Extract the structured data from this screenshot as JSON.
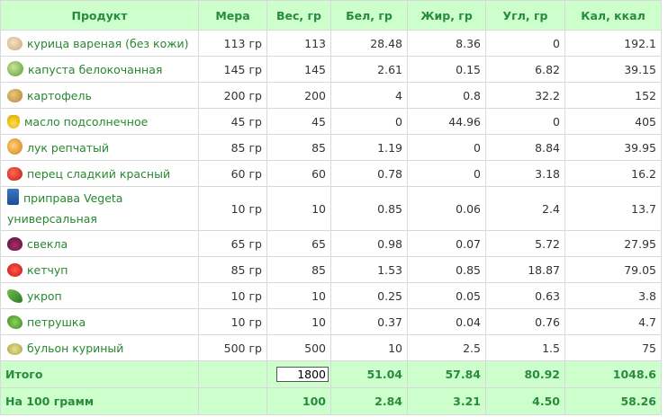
{
  "headers": {
    "product": "Продукт",
    "measure": "Мера",
    "weight": "Вес, гр",
    "protein": "Бел, гр",
    "fat": "Жир, гр",
    "carbs": "Угл, гр",
    "calories": "Кал, ккал"
  },
  "rows": [
    {
      "icon": "chicken-icon",
      "name": "курица вареная (без кожи)",
      "measure": "113 гр",
      "weight": "113",
      "protein": "28.48",
      "fat": "8.36",
      "carbs": "0",
      "calories": "192.1"
    },
    {
      "icon": "cabbage-icon",
      "name": "капуста белокочанная",
      "measure": "145 гр",
      "weight": "145",
      "protein": "2.61",
      "fat": "0.15",
      "carbs": "6.82",
      "calories": "39.15"
    },
    {
      "icon": "potato-icon",
      "name": "картофель",
      "measure": "200 гр",
      "weight": "200",
      "protein": "4",
      "fat": "0.8",
      "carbs": "32.2",
      "calories": "152"
    },
    {
      "icon": "oil-icon",
      "name": "масло подсолнечное",
      "measure": "45 гр",
      "weight": "45",
      "protein": "0",
      "fat": "44.96",
      "carbs": "0",
      "calories": "405"
    },
    {
      "icon": "onion-icon",
      "name": "лук репчатый",
      "measure": "85 гр",
      "weight": "85",
      "protein": "1.19",
      "fat": "0",
      "carbs": "8.84",
      "calories": "39.95"
    },
    {
      "icon": "pepper-icon",
      "name": "перец сладкий красный",
      "measure": "60 гр",
      "weight": "60",
      "protein": "0.78",
      "fat": "0",
      "carbs": "3.18",
      "calories": "16.2"
    },
    {
      "icon": "vegeta-icon",
      "name": "приправа Vegeta универсальная",
      "measure": "10 гр",
      "weight": "10",
      "protein": "0.85",
      "fat": "0.06",
      "carbs": "2.4",
      "calories": "13.7"
    },
    {
      "icon": "beet-icon",
      "name": "свекла",
      "measure": "65 гр",
      "weight": "65",
      "protein": "0.98",
      "fat": "0.07",
      "carbs": "5.72",
      "calories": "27.95"
    },
    {
      "icon": "ketchup-icon",
      "name": "кетчуп",
      "measure": "85 гр",
      "weight": "85",
      "protein": "1.53",
      "fat": "0.85",
      "carbs": "18.87",
      "calories": "79.05"
    },
    {
      "icon": "dill-icon",
      "name": "укроп",
      "measure": "10 гр",
      "weight": "10",
      "protein": "0.25",
      "fat": "0.05",
      "carbs": "0.63",
      "calories": "3.8"
    },
    {
      "icon": "parsley-icon",
      "name": "петрушка",
      "measure": "10 гр",
      "weight": "10",
      "protein": "0.37",
      "fat": "0.04",
      "carbs": "0.76",
      "calories": "4.7"
    },
    {
      "icon": "broth-icon",
      "name": "бульон куриный",
      "measure": "500 гр",
      "weight": "500",
      "protein": "10",
      "fat": "2.5",
      "carbs": "1.5",
      "calories": "75"
    }
  ],
  "total": {
    "label": "Итого",
    "weight_value": "1800",
    "protein": "51.04",
    "fat": "57.84",
    "carbs": "80.92",
    "calories": "1048.6"
  },
  "per100": {
    "label": "На 100 грамм",
    "weight": "100",
    "protein": "2.84",
    "fat": "3.21",
    "carbs": "4.50",
    "calories": "58.26"
  },
  "colors": {
    "header_bg": "#ccffcc",
    "header_text": "#2a8a3e",
    "product_text": "#27882f",
    "border": "#d9d9d9"
  }
}
